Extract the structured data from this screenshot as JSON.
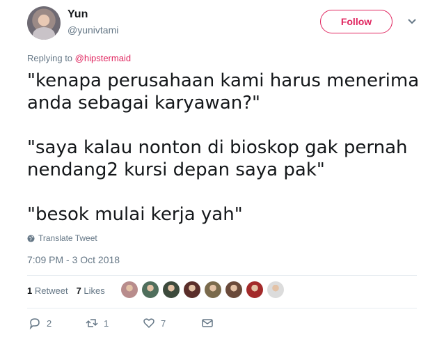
{
  "user": {
    "name": "Yun",
    "handle": "@yunivtami"
  },
  "follow_label": "Follow",
  "replying": {
    "prefix": "Replying to",
    "mention": "@hipstermaid"
  },
  "tweet_text": "\"kenapa perusahaan kami harus menerima\nanda sebagai karyawan?\"\n\n\"saya kalau nonton di bioskop gak pernah\nnendang2 kursi depan saya pak\"\n\n\"besok mulai kerja yah\"",
  "translate_label": "Translate Tweet",
  "timestamp": "7:09 PM - 3 Oct 2018",
  "stats": {
    "retweets_count": "1",
    "retweets_label": "Retweet",
    "likes_count": "7",
    "likes_label": "Likes"
  },
  "actions": {
    "reply_count": "2",
    "retweet_count": "1",
    "like_count": "7"
  },
  "colors": {
    "accent": "#e0245e",
    "secondary_text": "#657786",
    "divider": "#e6ecf0"
  },
  "icons": [
    "chevron-down-icon",
    "globe-icon",
    "reply-icon",
    "retweet-icon",
    "heart-icon",
    "message-icon"
  ],
  "likers": [
    {
      "color": "#b88c8c"
    },
    {
      "color": "#4f6e5c"
    },
    {
      "color": "#3c4a3c"
    },
    {
      "color": "#5a2e2a"
    },
    {
      "color": "#7a6a4c"
    },
    {
      "color": "#6a4a3a"
    },
    {
      "color": "#a32a2a"
    },
    {
      "color": "#dcdcdc"
    }
  ]
}
